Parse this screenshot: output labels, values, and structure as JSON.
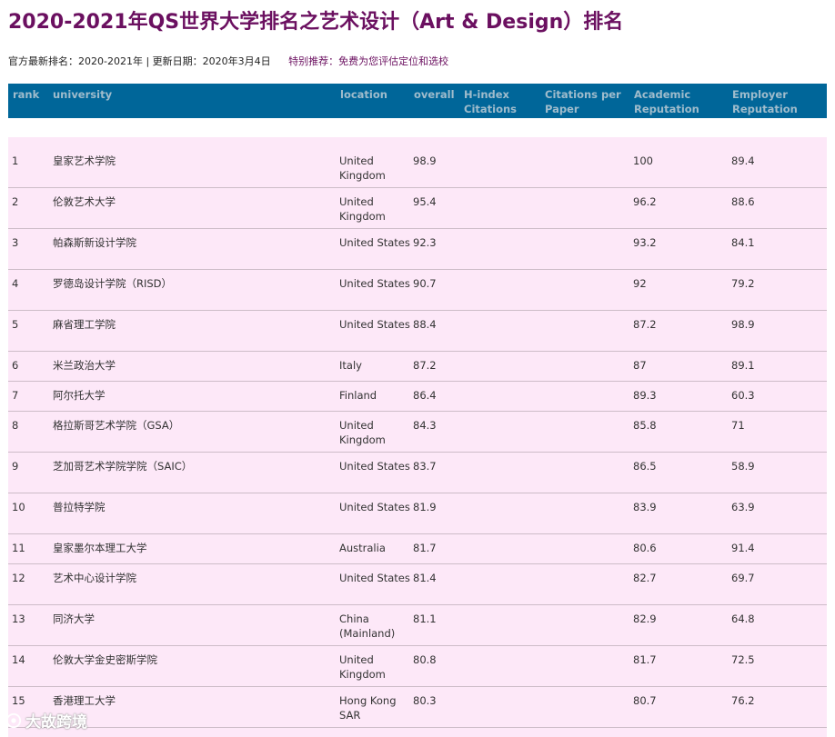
{
  "title": "2020-2021年QS世界大学排名之艺术设计（Art & Design）排名",
  "meta": {
    "info": "官方最新排名：2020-2021年 | 更新日期：2020年3月4日",
    "link": "特别推荐：免费为您评估定位和选校"
  },
  "columns": {
    "rank": "rank",
    "university": "university",
    "location": "location",
    "overall": "overall",
    "hindex": "H-index Citations",
    "citations": "Citations per Paper",
    "academic": "Academic Reputation",
    "employer": "Employer Reputation"
  },
  "rows": [
    {
      "rank": "1",
      "university": "皇家艺术学院",
      "location": "United Kingdom",
      "overall": "98.9",
      "hindex": "",
      "citations": "",
      "academic": "100",
      "employer": "89.4"
    },
    {
      "rank": "2",
      "university": "伦敦艺术大学",
      "location": "United Kingdom",
      "overall": "95.4",
      "hindex": "",
      "citations": "",
      "academic": "96.2",
      "employer": "88.6"
    },
    {
      "rank": "3",
      "university": "帕森斯新设计学院",
      "location": "United States",
      "overall": "92.3",
      "hindex": "",
      "citations": "",
      "academic": "93.2",
      "employer": "84.1"
    },
    {
      "rank": "4",
      "university": "罗德岛设计学院（RISD）",
      "location": "United States",
      "overall": "90.7",
      "hindex": "",
      "citations": "",
      "academic": "92",
      "employer": "79.2"
    },
    {
      "rank": "5",
      "university": "麻省理工学院",
      "location": "United States",
      "overall": "88.4",
      "hindex": "",
      "citations": "",
      "academic": "87.2",
      "employer": "98.9"
    },
    {
      "rank": "6",
      "university": "米兰政治大学",
      "location": "Italy",
      "overall": "87.2",
      "hindex": "",
      "citations": "",
      "academic": "87",
      "employer": "89.1"
    },
    {
      "rank": "7",
      "university": "阿尔托大学",
      "location": "Finland",
      "overall": "86.4",
      "hindex": "",
      "citations": "",
      "academic": "89.3",
      "employer": "60.3"
    },
    {
      "rank": "8",
      "university": "格拉斯哥艺术学院（GSA）",
      "location": "United Kingdom",
      "overall": "84.3",
      "hindex": "",
      "citations": "",
      "academic": "85.8",
      "employer": "71"
    },
    {
      "rank": "9",
      "university": "芝加哥艺术学院学院（SAIC）",
      "location": "United States",
      "overall": "83.7",
      "hindex": "",
      "citations": "",
      "academic": "86.5",
      "employer": "58.9"
    },
    {
      "rank": "10",
      "university": "普拉特学院",
      "location": "United States",
      "overall": "81.9",
      "hindex": "",
      "citations": "",
      "academic": "83.9",
      "employer": "63.9"
    },
    {
      "rank": "11",
      "university": "皇家墨尔本理工大学",
      "location": "Australia",
      "overall": "81.7",
      "hindex": "",
      "citations": "",
      "academic": "80.6",
      "employer": "91.4"
    },
    {
      "rank": "12",
      "university": "艺术中心设计学院",
      "location": "United States",
      "overall": "81.4",
      "hindex": "",
      "citations": "",
      "academic": "82.7",
      "employer": "69.7"
    },
    {
      "rank": "13",
      "university": "同济大学",
      "location": "China (Mainland)",
      "overall": "81.1",
      "hindex": "",
      "citations": "",
      "academic": "82.9",
      "employer": "64.8"
    },
    {
      "rank": "14",
      "university": "伦敦大学金史密斯学院",
      "location": "United Kingdom",
      "overall": "80.8",
      "hindex": "",
      "citations": "",
      "academic": "81.7",
      "employer": "72.5"
    },
    {
      "rank": "15",
      "university": "香港理工大学",
      "location": "Hong Kong SAR",
      "overall": "80.3",
      "hindex": "",
      "citations": "",
      "academic": "80.7",
      "employer": "76.2"
    }
  ],
  "watermark": "大故跨境",
  "colors": {
    "title": "#6b1060",
    "header_bg": "#006699",
    "row_bg": "#fde8f8"
  }
}
